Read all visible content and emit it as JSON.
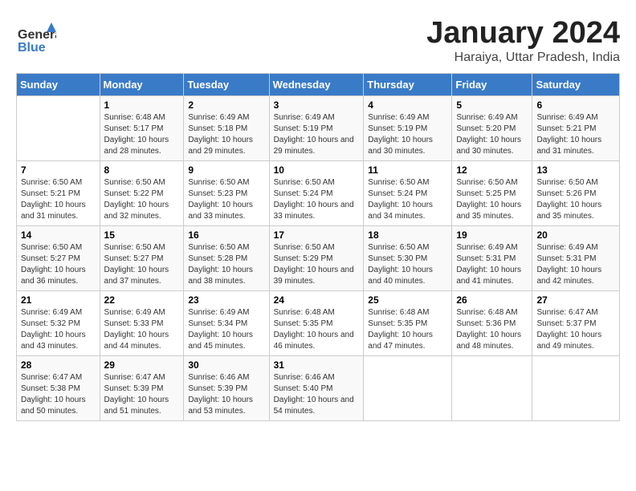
{
  "logo": {
    "general": "General",
    "blue": "Blue"
  },
  "title": "January 2024",
  "subtitle": "Haraiya, Uttar Pradesh, India",
  "days_of_week": [
    "Sunday",
    "Monday",
    "Tuesday",
    "Wednesday",
    "Thursday",
    "Friday",
    "Saturday"
  ],
  "weeks": [
    [
      {
        "num": "",
        "sunrise": "",
        "sunset": "",
        "daylight": ""
      },
      {
        "num": "1",
        "sunrise": "Sunrise: 6:48 AM",
        "sunset": "Sunset: 5:17 PM",
        "daylight": "Daylight: 10 hours and 28 minutes."
      },
      {
        "num": "2",
        "sunrise": "Sunrise: 6:49 AM",
        "sunset": "Sunset: 5:18 PM",
        "daylight": "Daylight: 10 hours and 29 minutes."
      },
      {
        "num": "3",
        "sunrise": "Sunrise: 6:49 AM",
        "sunset": "Sunset: 5:19 PM",
        "daylight": "Daylight: 10 hours and 29 minutes."
      },
      {
        "num": "4",
        "sunrise": "Sunrise: 6:49 AM",
        "sunset": "Sunset: 5:19 PM",
        "daylight": "Daylight: 10 hours and 30 minutes."
      },
      {
        "num": "5",
        "sunrise": "Sunrise: 6:49 AM",
        "sunset": "Sunset: 5:20 PM",
        "daylight": "Daylight: 10 hours and 30 minutes."
      },
      {
        "num": "6",
        "sunrise": "Sunrise: 6:49 AM",
        "sunset": "Sunset: 5:21 PM",
        "daylight": "Daylight: 10 hours and 31 minutes."
      }
    ],
    [
      {
        "num": "7",
        "sunrise": "Sunrise: 6:50 AM",
        "sunset": "Sunset: 5:21 PM",
        "daylight": "Daylight: 10 hours and 31 minutes."
      },
      {
        "num": "8",
        "sunrise": "Sunrise: 6:50 AM",
        "sunset": "Sunset: 5:22 PM",
        "daylight": "Daylight: 10 hours and 32 minutes."
      },
      {
        "num": "9",
        "sunrise": "Sunrise: 6:50 AM",
        "sunset": "Sunset: 5:23 PM",
        "daylight": "Daylight: 10 hours and 33 minutes."
      },
      {
        "num": "10",
        "sunrise": "Sunrise: 6:50 AM",
        "sunset": "Sunset: 5:24 PM",
        "daylight": "Daylight: 10 hours and 33 minutes."
      },
      {
        "num": "11",
        "sunrise": "Sunrise: 6:50 AM",
        "sunset": "Sunset: 5:24 PM",
        "daylight": "Daylight: 10 hours and 34 minutes."
      },
      {
        "num": "12",
        "sunrise": "Sunrise: 6:50 AM",
        "sunset": "Sunset: 5:25 PM",
        "daylight": "Daylight: 10 hours and 35 minutes."
      },
      {
        "num": "13",
        "sunrise": "Sunrise: 6:50 AM",
        "sunset": "Sunset: 5:26 PM",
        "daylight": "Daylight: 10 hours and 35 minutes."
      }
    ],
    [
      {
        "num": "14",
        "sunrise": "Sunrise: 6:50 AM",
        "sunset": "Sunset: 5:27 PM",
        "daylight": "Daylight: 10 hours and 36 minutes."
      },
      {
        "num": "15",
        "sunrise": "Sunrise: 6:50 AM",
        "sunset": "Sunset: 5:27 PM",
        "daylight": "Daylight: 10 hours and 37 minutes."
      },
      {
        "num": "16",
        "sunrise": "Sunrise: 6:50 AM",
        "sunset": "Sunset: 5:28 PM",
        "daylight": "Daylight: 10 hours and 38 minutes."
      },
      {
        "num": "17",
        "sunrise": "Sunrise: 6:50 AM",
        "sunset": "Sunset: 5:29 PM",
        "daylight": "Daylight: 10 hours and 39 minutes."
      },
      {
        "num": "18",
        "sunrise": "Sunrise: 6:50 AM",
        "sunset": "Sunset: 5:30 PM",
        "daylight": "Daylight: 10 hours and 40 minutes."
      },
      {
        "num": "19",
        "sunrise": "Sunrise: 6:49 AM",
        "sunset": "Sunset: 5:31 PM",
        "daylight": "Daylight: 10 hours and 41 minutes."
      },
      {
        "num": "20",
        "sunrise": "Sunrise: 6:49 AM",
        "sunset": "Sunset: 5:31 PM",
        "daylight": "Daylight: 10 hours and 42 minutes."
      }
    ],
    [
      {
        "num": "21",
        "sunrise": "Sunrise: 6:49 AM",
        "sunset": "Sunset: 5:32 PM",
        "daylight": "Daylight: 10 hours and 43 minutes."
      },
      {
        "num": "22",
        "sunrise": "Sunrise: 6:49 AM",
        "sunset": "Sunset: 5:33 PM",
        "daylight": "Daylight: 10 hours and 44 minutes."
      },
      {
        "num": "23",
        "sunrise": "Sunrise: 6:49 AM",
        "sunset": "Sunset: 5:34 PM",
        "daylight": "Daylight: 10 hours and 45 minutes."
      },
      {
        "num": "24",
        "sunrise": "Sunrise: 6:48 AM",
        "sunset": "Sunset: 5:35 PM",
        "daylight": "Daylight: 10 hours and 46 minutes."
      },
      {
        "num": "25",
        "sunrise": "Sunrise: 6:48 AM",
        "sunset": "Sunset: 5:35 PM",
        "daylight": "Daylight: 10 hours and 47 minutes."
      },
      {
        "num": "26",
        "sunrise": "Sunrise: 6:48 AM",
        "sunset": "Sunset: 5:36 PM",
        "daylight": "Daylight: 10 hours and 48 minutes."
      },
      {
        "num": "27",
        "sunrise": "Sunrise: 6:47 AM",
        "sunset": "Sunset: 5:37 PM",
        "daylight": "Daylight: 10 hours and 49 minutes."
      }
    ],
    [
      {
        "num": "28",
        "sunrise": "Sunrise: 6:47 AM",
        "sunset": "Sunset: 5:38 PM",
        "daylight": "Daylight: 10 hours and 50 minutes."
      },
      {
        "num": "29",
        "sunrise": "Sunrise: 6:47 AM",
        "sunset": "Sunset: 5:39 PM",
        "daylight": "Daylight: 10 hours and 51 minutes."
      },
      {
        "num": "30",
        "sunrise": "Sunrise: 6:46 AM",
        "sunset": "Sunset: 5:39 PM",
        "daylight": "Daylight: 10 hours and 53 minutes."
      },
      {
        "num": "31",
        "sunrise": "Sunrise: 6:46 AM",
        "sunset": "Sunset: 5:40 PM",
        "daylight": "Daylight: 10 hours and 54 minutes."
      },
      {
        "num": "",
        "sunrise": "",
        "sunset": "",
        "daylight": ""
      },
      {
        "num": "",
        "sunrise": "",
        "sunset": "",
        "daylight": ""
      },
      {
        "num": "",
        "sunrise": "",
        "sunset": "",
        "daylight": ""
      }
    ]
  ]
}
